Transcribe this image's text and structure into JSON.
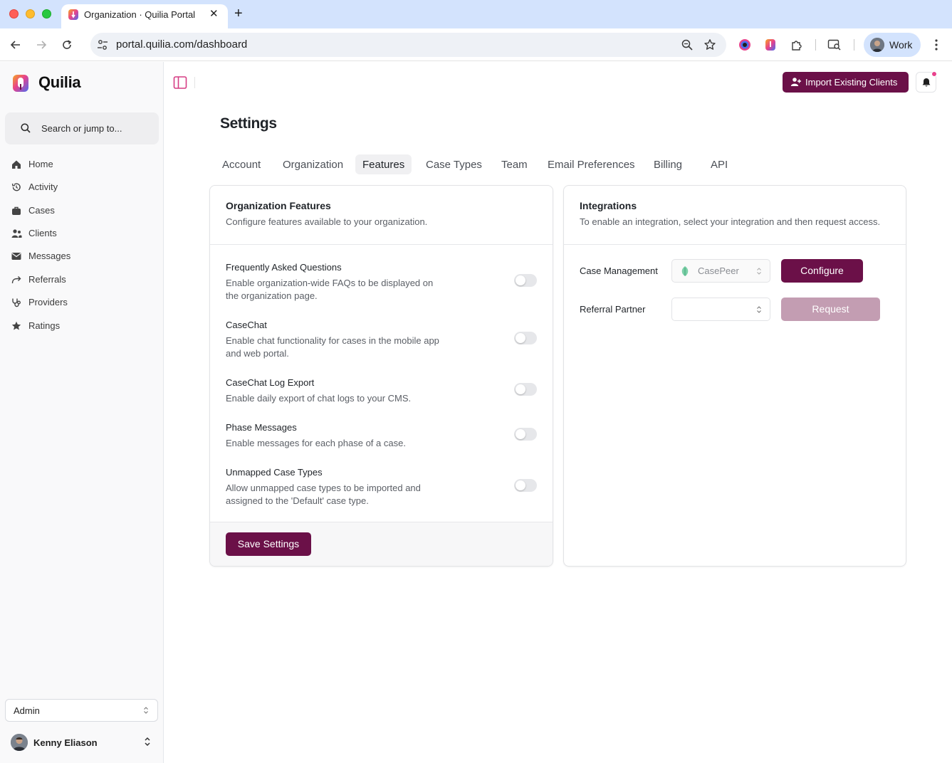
{
  "browser": {
    "tab_title": "Organization · Quilia Portal",
    "url": "portal.quilia.com/dashboard",
    "profile_label": "Work"
  },
  "brand": {
    "name": "Quilia",
    "accent": "#6b1048",
    "accent_disabled": "#c39db2"
  },
  "sidebar": {
    "search_placeholder": "Search or jump to...",
    "items": [
      {
        "label": "Home",
        "icon": "home-icon"
      },
      {
        "label": "Activity",
        "icon": "history-icon"
      },
      {
        "label": "Cases",
        "icon": "briefcase-icon"
      },
      {
        "label": "Clients",
        "icon": "users-icon"
      },
      {
        "label": "Messages",
        "icon": "mail-icon"
      },
      {
        "label": "Referrals",
        "icon": "forward-arrow-icon"
      },
      {
        "label": "Providers",
        "icon": "stethoscope-icon"
      },
      {
        "label": "Ratings",
        "icon": "star-icon"
      }
    ],
    "role": "Admin",
    "user_name": "Kenny Eliason"
  },
  "header": {
    "import_label": "Import Existing Clients"
  },
  "settings": {
    "title": "Settings",
    "tabs": [
      {
        "label": "Account",
        "active": false
      },
      {
        "label": "Organization",
        "active": false
      },
      {
        "label": "Features",
        "active": true
      },
      {
        "label": "Case Types",
        "active": false
      },
      {
        "label": "Team",
        "active": false
      },
      {
        "label": "Email Preferences",
        "active": false
      },
      {
        "label": "Billing",
        "active": false
      },
      {
        "label": "API",
        "active": false
      }
    ],
    "features_card": {
      "title": "Organization Features",
      "subtitle": "Configure features available to your organization.",
      "features": [
        {
          "title": "Frequently Asked Questions",
          "description": "Enable organization-wide FAQs to be displayed on the organization page.",
          "enabled": false
        },
        {
          "title": "CaseChat",
          "description": "Enable chat functionality for cases in the mobile app and web portal.",
          "enabled": false
        },
        {
          "title": "CaseChat Log Export",
          "description": "Enable daily export of chat logs to your CMS.",
          "enabled": false
        },
        {
          "title": "Phase Messages",
          "description": "Enable messages for each phase of a case.",
          "enabled": false
        },
        {
          "title": "Unmapped Case Types",
          "description": "Allow unmapped case types to be imported and assigned to the 'Default' case type.",
          "enabled": false
        }
      ],
      "save_label": "Save Settings"
    },
    "integrations_card": {
      "title": "Integrations",
      "subtitle": "To enable an integration, select your integration and then request access.",
      "rows": [
        {
          "label": "Case Management",
          "selected": "CasePeer",
          "action": "Configure"
        },
        {
          "label": "Referral Partner",
          "selected": "",
          "action": "Request"
        }
      ]
    }
  }
}
